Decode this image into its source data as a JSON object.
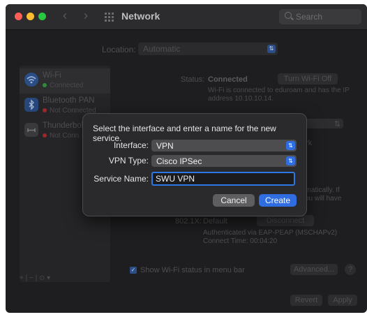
{
  "window": {
    "title": "Network",
    "search_placeholder": "Search"
  },
  "location": {
    "label": "Location:",
    "value": "Automatic"
  },
  "sidebar": {
    "services": [
      {
        "name": "Wi-Fi",
        "status": "Connected",
        "status_color": "#2f8a3a"
      },
      {
        "name": "Bluetooth PAN",
        "status": "Not Connected",
        "status_color": "#9a2a2a"
      },
      {
        "name": "Thunderbolt",
        "status": "Not Conn",
        "status_color": "#9a2a2a"
      }
    ],
    "bottom_controls": "+ | − | ⊙ ▾"
  },
  "detail": {
    "status_label": "Status:",
    "status_value": "Connected",
    "turn_off_button": "Turn Wi-Fi Off",
    "status_desc": "Wi-Fi is connected to eduroam and has the IP address 10.10.10.14.",
    "fragment_ork": "ork",
    "fragment_ts": "ts",
    "auto_text_1": "omatically. If",
    "auto_text_2": "you will have",
    "dot1x_label": "802.1X:",
    "dot1x_value": "Default",
    "disconnect_button": "Disconnect",
    "auth_line1": "Authenticated via EAP-PEAP (MSCHAPv2)",
    "auth_line2": "Connect Time: 00:04:20",
    "show_wifi_checkbox": "Show Wi-Fi status in menu bar",
    "advanced_button": "Advanced...",
    "help_button": "?",
    "revert_button": "Revert",
    "apply_button": "Apply"
  },
  "dialog": {
    "message": "Select the interface and enter a name for the new service.",
    "interface_label": "Interface:",
    "interface_value": "VPN",
    "vpn_type_label": "VPN Type:",
    "vpn_type_value": "Cisco IPSec",
    "service_name_label": "Service Name:",
    "service_name_value": "SWU VPN",
    "cancel_button": "Cancel",
    "create_button": "Create"
  },
  "colors": {
    "accent": "#2f6de1",
    "window_bg": "#1e1e20",
    "dialog_bg": "#2a2a2c"
  }
}
